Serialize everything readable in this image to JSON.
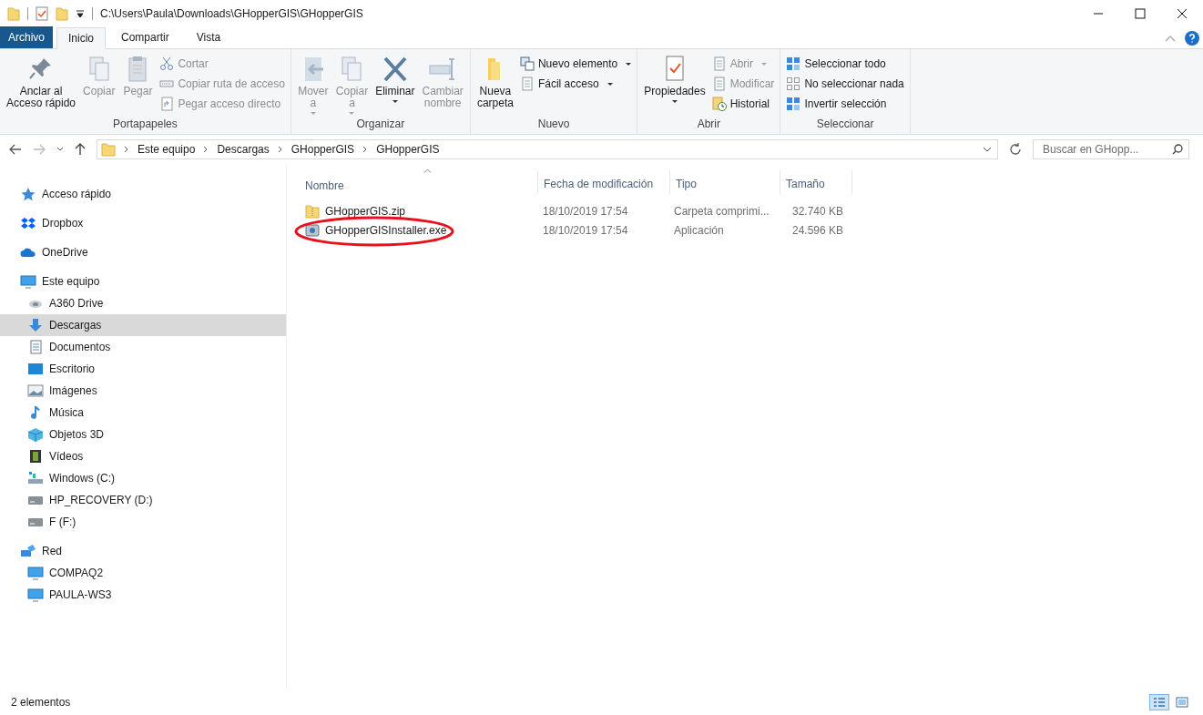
{
  "window": {
    "title": "C:\\Users\\Paula\\Downloads\\GHopperGIS\\GHopperGIS"
  },
  "ribbon": {
    "tabs": [
      {
        "label": "Archivo",
        "kind": "file",
        "selected": false
      },
      {
        "label": "Inicio",
        "kind": "tab",
        "selected": true
      },
      {
        "label": "Compartir",
        "kind": "tab",
        "selected": false
      },
      {
        "label": "Vista",
        "kind": "tab",
        "selected": false
      }
    ],
    "groups": [
      {
        "label": "Portapapeles",
        "items": [
          {
            "label": "Anclar al\nAcceso rápido",
            "kind": "large",
            "disabled": false,
            "dropdown": false
          },
          {
            "label": "Copiar",
            "kind": "large",
            "disabled": true,
            "dropdown": false
          },
          {
            "label": "Pegar",
            "kind": "large",
            "disabled": true,
            "dropdown": false
          },
          {
            "label": "Cortar",
            "kind": "small",
            "disabled": true,
            "dropdown": false
          },
          {
            "label": "Copiar ruta de acceso",
            "kind": "small",
            "disabled": true,
            "dropdown": false
          },
          {
            "label": "Pegar acceso directo",
            "kind": "small",
            "disabled": true,
            "dropdown": false
          }
        ]
      },
      {
        "label": "Organizar",
        "items": [
          {
            "label": "Mover\na",
            "kind": "large",
            "disabled": true,
            "dropdown": true
          },
          {
            "label": "Copiar\na",
            "kind": "large",
            "disabled": true,
            "dropdown": true
          },
          {
            "label": "Eliminar",
            "kind": "large",
            "disabled": false,
            "dropdown": true
          },
          {
            "label": "Cambiar\nnombre",
            "kind": "large",
            "disabled": true,
            "dropdown": false
          }
        ]
      },
      {
        "label": "Nuevo",
        "items": [
          {
            "label": "Nueva\ncarpeta",
            "kind": "large",
            "disabled": false,
            "dropdown": false
          },
          {
            "label": "Nuevo elemento",
            "kind": "small",
            "disabled": false,
            "dropdown": true
          },
          {
            "label": "Fácil acceso",
            "kind": "small",
            "disabled": false,
            "dropdown": true
          }
        ]
      },
      {
        "label": "Abrir",
        "items": [
          {
            "label": "Propiedades",
            "kind": "large",
            "disabled": false,
            "dropdown": true
          },
          {
            "label": "Abrir",
            "kind": "small",
            "disabled": true,
            "dropdown": true
          },
          {
            "label": "Modificar",
            "kind": "small",
            "disabled": true,
            "dropdown": false
          },
          {
            "label": "Historial",
            "kind": "small",
            "disabled": false,
            "dropdown": false
          }
        ]
      },
      {
        "label": "Seleccionar",
        "items": [
          {
            "label": "Seleccionar todo",
            "kind": "small",
            "disabled": false,
            "dropdown": false
          },
          {
            "label": "No seleccionar nada",
            "kind": "small",
            "disabled": false,
            "dropdown": false
          },
          {
            "label": "Invertir selección",
            "kind": "small",
            "disabled": false,
            "dropdown": false
          }
        ]
      }
    ]
  },
  "address": {
    "crumbs": [
      "Este equipo",
      "Descargas",
      "GHopperGIS",
      "GHopperGIS"
    ],
    "search": {
      "placeholder": "Buscar en GHopp..."
    }
  },
  "sidebar": {
    "items": [
      {
        "label": "Acceso rápido",
        "selected": false
      },
      {
        "label": "Dropbox",
        "selected": false
      },
      {
        "label": "OneDrive",
        "selected": false
      },
      {
        "label": "Este equipo",
        "selected": false,
        "children": [
          {
            "label": "A360 Drive",
            "selected": false
          },
          {
            "label": "Descargas",
            "selected": true
          },
          {
            "label": "Documentos",
            "selected": false
          },
          {
            "label": "Escritorio",
            "selected": false
          },
          {
            "label": "Imágenes",
            "selected": false
          },
          {
            "label": "Música",
            "selected": false
          },
          {
            "label": "Objetos 3D",
            "selected": false
          },
          {
            "label": "Vídeos",
            "selected": false
          },
          {
            "label": "Windows  (C:)",
            "selected": false
          },
          {
            "label": "HP_RECOVERY (D:)",
            "selected": false
          },
          {
            "label": "F (F:)",
            "selected": false
          }
        ]
      },
      {
        "label": "Red",
        "selected": false,
        "children": [
          {
            "label": "COMPAQ2",
            "selected": false
          },
          {
            "label": "PAULA-WS3",
            "selected": false
          }
        ]
      }
    ]
  },
  "table": {
    "columns": [
      "Nombre",
      "Fecha de modificación",
      "Tipo",
      "Tamaño"
    ],
    "rows": [
      {
        "name": "GHopperGIS.zip",
        "date": "18/10/2019 17:54",
        "type": "Carpeta comprimi...",
        "size": "32.740 KB",
        "kind": "zip"
      },
      {
        "name": "GHopperGISInstaller.exe",
        "date": "18/10/2019 17:54",
        "type": "Aplicación",
        "size": "24.596 KB",
        "kind": "exe",
        "circled": true
      }
    ]
  },
  "status_bar": {
    "count": "2 elementos",
    "views": [
      {
        "selected": true
      },
      {
        "selected": false
      }
    ]
  }
}
